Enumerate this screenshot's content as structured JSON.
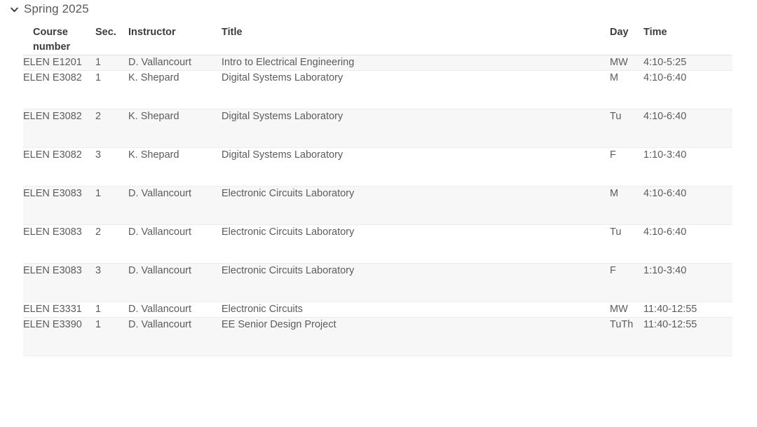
{
  "term": {
    "label": "Spring 2025",
    "toggle_icon": "chevron-down-icon",
    "expanded": true
  },
  "table": {
    "columns": [
      {
        "key": "course_number",
        "label": "Course number"
      },
      {
        "key": "section",
        "label": "Sec."
      },
      {
        "key": "instructor",
        "label": "Instructor"
      },
      {
        "key": "title",
        "label": "Title"
      },
      {
        "key": "day",
        "label": "Day"
      },
      {
        "key": "time",
        "label": "Time"
      }
    ],
    "rows": [
      {
        "course_number": "ELEN E1201",
        "section": "1",
        "instructor": "D. Vallancourt",
        "title": "Intro to Electrical Engineering",
        "day": "MW",
        "time": "4:10-5:25",
        "wrap": false
      },
      {
        "course_number": "ELEN E3082",
        "section": "1",
        "instructor": "K. Shepard",
        "title": "Digital Systems Laboratory",
        "day": "M",
        "time": "4:10-6:40",
        "wrap": true
      },
      {
        "course_number": "ELEN E3082",
        "section": "2",
        "instructor": "K. Shepard",
        "title": "Digital Systems Laboratory",
        "day": "Tu",
        "time": "4:10-6:40",
        "wrap": true
      },
      {
        "course_number": "ELEN E3082",
        "section": "3",
        "instructor": "K. Shepard",
        "title": "Digital Systems Laboratory",
        "day": "F",
        "time": "1:10-3:40",
        "wrap": true
      },
      {
        "course_number": "ELEN E3083",
        "section": "1",
        "instructor": "D. Vallancourt",
        "title": "Electronic Circuits Laboratory",
        "day": "M",
        "time": "4:10-6:40",
        "wrap": true
      },
      {
        "course_number": "ELEN E3083",
        "section": "2",
        "instructor": "D. Vallancourt",
        "title": "Electronic Circuits Laboratory",
        "day": "Tu",
        "time": "4:10-6:40",
        "wrap": true
      },
      {
        "course_number": "ELEN E3083",
        "section": "3",
        "instructor": "D. Vallancourt",
        "title": "Electronic Circuits Laboratory",
        "day": "F",
        "time": "1:10-3:40",
        "wrap": true
      },
      {
        "course_number": "ELEN E3331",
        "section": "1",
        "instructor": "D. Vallancourt",
        "title": "Electronic Circuits",
        "day": "MW",
        "time": "11:40-12:55",
        "wrap": false
      },
      {
        "course_number": "ELEN E3390",
        "section": "1",
        "instructor": "D. Vallancourt",
        "title": "EE Senior Design Project",
        "day": "TuTh",
        "time": "11:40-12:55",
        "wrap": true
      }
    ]
  },
  "colors": {
    "page_background": "#ffffff",
    "heading_text": "#595959",
    "header_text": "#3c3c3c",
    "body_text": "#5c5c5c",
    "row_alt_background": "#f7f7f7",
    "row_border": "#ededed",
    "header_border": "#e2e2e2"
  }
}
